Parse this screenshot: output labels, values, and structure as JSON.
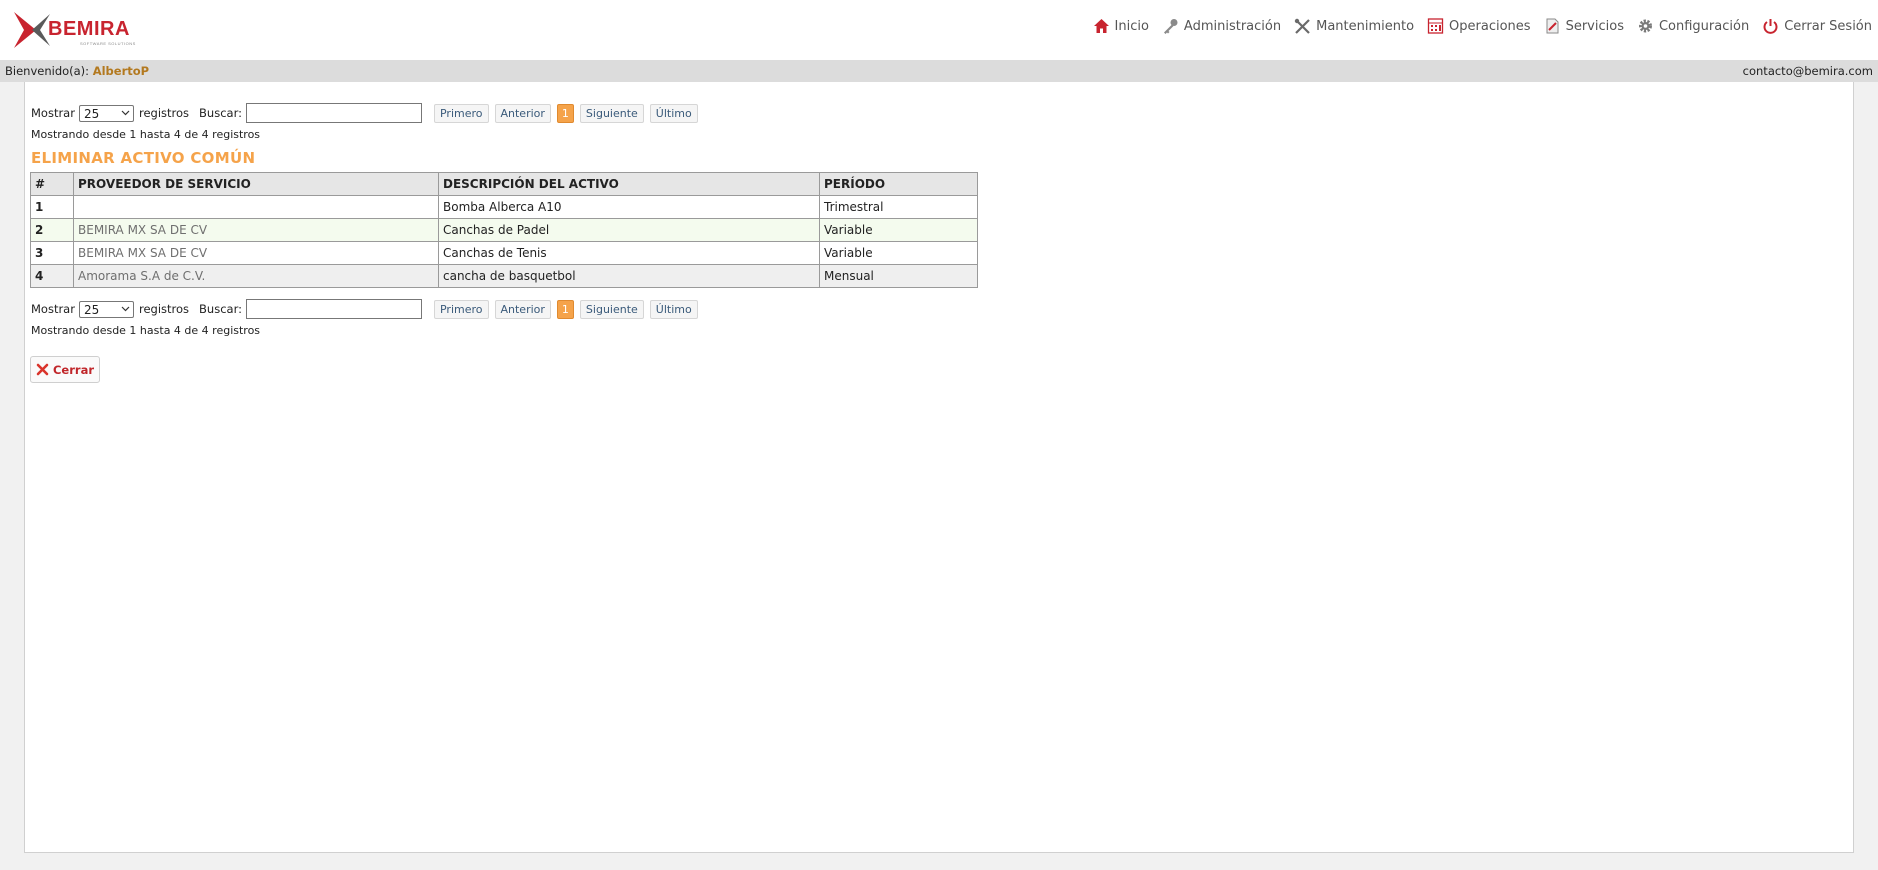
{
  "brand": {
    "name": "BEMIRA",
    "tagline": "SOFTWARE SOLUTIONS"
  },
  "nav": [
    {
      "label": "Inicio",
      "icon": "home-icon"
    },
    {
      "label": "Administración",
      "icon": "key-icon"
    },
    {
      "label": "Mantenimiento",
      "icon": "tools-icon"
    },
    {
      "label": "Operaciones",
      "icon": "calculator-icon"
    },
    {
      "label": "Servicios",
      "icon": "document-icon"
    },
    {
      "label": "Configuración",
      "icon": "gear-icon"
    },
    {
      "label": "Cerrar Sesión",
      "icon": "power-icon"
    }
  ],
  "welcome": {
    "label": "Bienvenido(a):",
    "user": "AlbertoP",
    "email": "contacto@bemira.com"
  },
  "controls": {
    "show_label": "Mostrar",
    "page_size": "25",
    "records_label": "registros",
    "search_label": "Buscar:",
    "search_value": "",
    "first": "Primero",
    "prev": "Anterior",
    "current_page": "1",
    "next": "Siguiente",
    "last": "Último",
    "info": "Mostrando desde 1 hasta 4 de 4 registros"
  },
  "title": "ELIMINAR ACTIVO COMÚN",
  "table": {
    "headers": [
      "#",
      "PROVEEDOR DE SERVICIO",
      "DESCRIPCIÓN DEL ACTIVO",
      "PERÍODO"
    ],
    "rows": [
      {
        "num": "1",
        "provider": "",
        "description": "Bomba Alberca A10",
        "period": "Trimestral"
      },
      {
        "num": "2",
        "provider": "BEMIRA MX SA DE CV",
        "description": "Canchas de Padel",
        "period": "Variable"
      },
      {
        "num": "3",
        "provider": "BEMIRA MX SA DE CV",
        "description": "Canchas de Tenis",
        "period": "Variable"
      },
      {
        "num": "4",
        "provider": "Amorama S.A de C.V.",
        "description": "cancha de basquetbol",
        "period": "Mensual"
      }
    ]
  },
  "close_button": {
    "label": "Cerrar",
    "icon": "close-x-icon"
  },
  "colors": {
    "accent": "#f5a34a",
    "brand_red": "#c8242f",
    "user_name": "#b3791f"
  }
}
